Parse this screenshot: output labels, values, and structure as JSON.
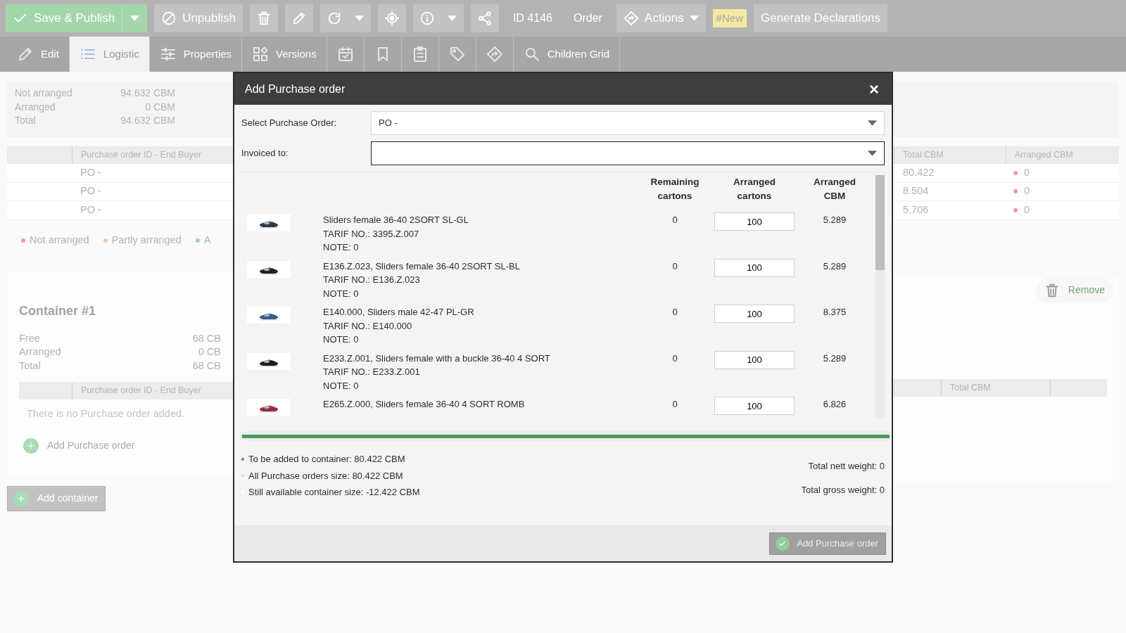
{
  "toolbar": [
    {
      "kind": "primary",
      "label": "Save & Publish",
      "dropdown": true
    },
    {
      "kind": "button",
      "label": "Unpublish"
    },
    {
      "kind": "icon"
    },
    {
      "kind": "icon"
    },
    {
      "kind": "icon",
      "dropdown": true
    },
    {
      "kind": "icon"
    },
    {
      "kind": "icon",
      "dropdown": true
    },
    {
      "kind": "icon"
    },
    {
      "kind": "text",
      "label": "ID 4146"
    },
    {
      "kind": "text",
      "label": "Order"
    },
    {
      "kind": "button",
      "label": "Actions",
      "dropdown": true
    },
    {
      "kind": "tag",
      "label": "#New"
    },
    {
      "kind": "button",
      "label": "Generate Declarations"
    }
  ],
  "tabs": [
    {
      "label": "Edit",
      "selected": false
    },
    {
      "label": "Logistic",
      "selected": true
    },
    {
      "label": "Properties",
      "selected": false
    },
    {
      "label": "Versions",
      "selected": false
    },
    {
      "selected": false
    },
    {
      "selected": false
    },
    {
      "selected": false
    },
    {
      "selected": false
    },
    {
      "selected": false
    },
    {
      "label": "Children Grid",
      "selected": false
    }
  ],
  "summary": [
    {
      "label": "Not arranged",
      "value": "94.632 CBM"
    },
    {
      "label": "Arranged",
      "value": "0 CBM"
    },
    {
      "label": "Total",
      "value": "94.632 CBM"
    }
  ],
  "orders_table": {
    "columns": [
      "Purchase order ID - End Buyer",
      "Total CBM",
      "Arranged CBM"
    ],
    "rows": [
      {
        "order": "PO -",
        "total_cbm": "80.422",
        "arranged_cbm": "0",
        "color": "#f29a9a"
      },
      {
        "order": "PO -",
        "total_cbm": "8.504",
        "arranged_cbm": "0",
        "color": "#f29a9a"
      },
      {
        "order": "PO -",
        "total_cbm": "5.706",
        "arranged_cbm": "0",
        "color": "#f29a9a"
      }
    ]
  },
  "legend": [
    {
      "label": "Not arranged",
      "color": "#f29a9a"
    },
    {
      "label": "Partly arranged",
      "color": "#f5c79a"
    },
    {
      "label": "A",
      "color": "#a3d3ad"
    }
  ],
  "container": {
    "title": "Container #1",
    "remove_label": "Remove",
    "stats": [
      {
        "label": "Free",
        "value": "68 CB"
      },
      {
        "label": "Arranged",
        "value": "0 CB"
      },
      {
        "label": "Total",
        "value": "68 CB"
      }
    ],
    "columns": [
      "Purchase order ID - End Buyer",
      "Total CBM"
    ],
    "empty_message": "There is no Purchase order added.",
    "add_label": "Add Purchase order"
  },
  "add_container": "Add container",
  "dialog": {
    "title": "Add Purchase order",
    "close": "×",
    "fields": [
      {
        "label": "Select Purchase Order:",
        "value": "PO -",
        "focused": false
      },
      {
        "label": "Invoiced to:",
        "focused": true
      }
    ],
    "columns": [
      "Remaining cartons",
      "Arranged cartons",
      "Arranged CBM"
    ],
    "items": [
      {
        "name": "Sliders female 36-40 2SORT SL-GL",
        "tarif": "TARIF NO.: 3395.Z.007",
        "note": "NOTE: 0",
        "remaining": "0",
        "arranged": "100",
        "cbm": "5.289"
      },
      {
        "name": "E136.Z.023, Sliders female 36-40 2SORT SL-BL",
        "tarif": "TARIF NO.: E136.Z.023",
        "note": "NOTE: 0",
        "remaining": "0",
        "arranged": "100",
        "cbm": "5.289"
      },
      {
        "name": "E140.000, Sliders male 42-47 PL-GR",
        "tarif": "TARIF NO.: E140.000",
        "note": "NOTE: 0",
        "remaining": "0",
        "arranged": "100",
        "cbm": "8.375"
      },
      {
        "name": "E233.Z.001, Sliders female with a buckle 36-40 4 SORT",
        "tarif": "TARIF NO.: E233.Z.001",
        "note": "NOTE: 0",
        "remaining": "0",
        "arranged": "100",
        "cbm": "5.289"
      },
      {
        "name": "E265.Z.000, Sliders female 36-40 4 SORT ROMB",
        "remaining": "0",
        "arranged": "100",
        "cbm": "6.826"
      }
    ],
    "progress": {
      "level": 1
    },
    "totals": [
      {
        "text": "To be added to container: 80.422 CBM",
        "color": "#4c9a5a"
      },
      {
        "text": "All Purchase orders size: 80.422 CBM",
        "color": "#dcdcdc"
      },
      {
        "text": "Still available container size: -12.422 CBM",
        "color": "#ffffff"
      }
    ],
    "weights": [
      "Total nett weight: 0",
      "Total gross weight: 0"
    ],
    "submit": {
      "label": "Add Purchase order",
      "disabled": true
    }
  }
}
